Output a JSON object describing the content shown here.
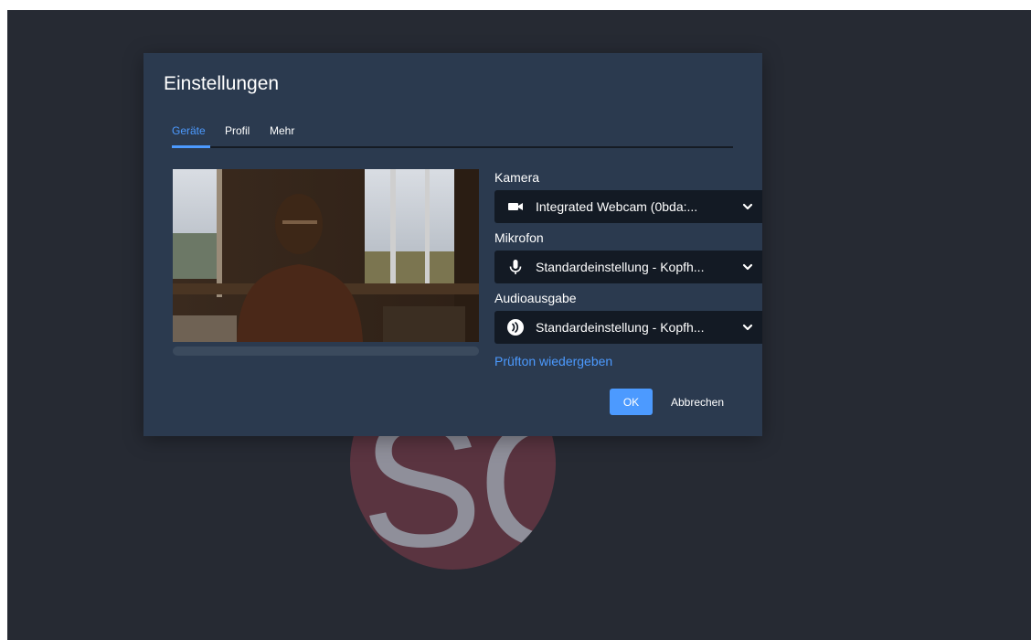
{
  "dialog": {
    "title": "Einstellungen",
    "tabs": [
      {
        "label": "Geräte",
        "active": true
      },
      {
        "label": "Profil",
        "active": false
      },
      {
        "label": "Mehr",
        "active": false
      }
    ]
  },
  "devices": {
    "camera": {
      "label": "Kamera",
      "value": "Integrated Webcam (0bda:...",
      "icon": "video-camera-icon"
    },
    "microphone": {
      "label": "Mikrofon",
      "value": "Standardeinstellung - Kopfh...",
      "icon": "microphone-icon"
    },
    "audio_output": {
      "label": "Audioausgabe",
      "value": "Standardeinstellung - Kopfh...",
      "icon": "speaker-icon"
    }
  },
  "test_sound_link": "Prüfton wiedergeben",
  "buttons": {
    "ok": "OK",
    "cancel": "Abbrechen"
  },
  "background_avatar": {
    "text": "SC"
  },
  "colors": {
    "accent": "#4c9aff",
    "dialog_bg": "#2b3a4f",
    "page_bg": "#262a33",
    "select_bg": "#131a24",
    "avatar_bg": "#5a3440"
  }
}
